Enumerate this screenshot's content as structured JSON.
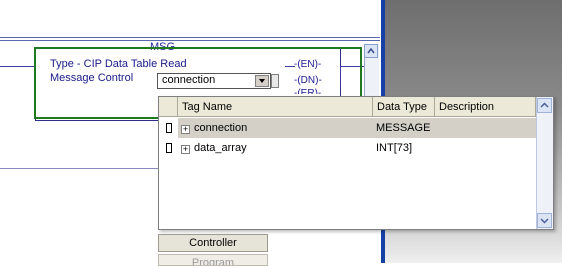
{
  "ladder": {
    "instruction_title": "MSG",
    "type_line": "Type - CIP Data Table Read",
    "control_label": "Message Control",
    "control_value": "connection",
    "coils": [
      "EN",
      "DN",
      "ER"
    ]
  },
  "tag_browser": {
    "columns": [
      "Tag Name",
      "Data Type",
      "Description"
    ],
    "rows": [
      {
        "name": "connection",
        "type": "MESSAGE",
        "description": "",
        "selected": true
      },
      {
        "name": "data_array",
        "type": "INT[73]",
        "description": "",
        "selected": false
      }
    ],
    "scope_buttons": [
      "Controller",
      "Program"
    ]
  },
  "colors": {
    "rung_border": "#1f7a1f",
    "ladder_text": "#1a1a8a",
    "selection": "#d4d0c8",
    "right_edge": "#173fa6"
  },
  "icons": {
    "dropdown": "chevron-down-icon",
    "expand": "plus-icon",
    "tag": "tag-icon",
    "scroll_up": "chevron-up-icon",
    "scroll_down": "chevron-down-icon"
  }
}
